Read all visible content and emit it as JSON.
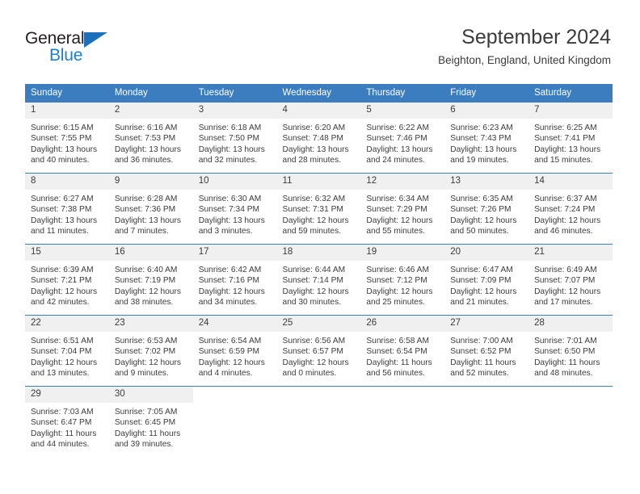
{
  "brand": {
    "name_primary": "General",
    "name_secondary": "Blue"
  },
  "header": {
    "title": "September 2024",
    "location": "Beighton, England, United Kingdom"
  },
  "columns": [
    "Sunday",
    "Monday",
    "Tuesday",
    "Wednesday",
    "Thursday",
    "Friday",
    "Saturday"
  ],
  "colors": {
    "header_blue": "#3b7dbf",
    "logo_blue": "#1c7fd0",
    "daynum_bg": "#f0f0f0",
    "text": "#3b3b3b"
  },
  "weeks": [
    [
      {
        "day": "1",
        "sunrise": "Sunrise: 6:15 AM",
        "sunset": "Sunset: 7:55 PM",
        "daylight": "Daylight: 13 hours and 40 minutes."
      },
      {
        "day": "2",
        "sunrise": "Sunrise: 6:16 AM",
        "sunset": "Sunset: 7:53 PM",
        "daylight": "Daylight: 13 hours and 36 minutes."
      },
      {
        "day": "3",
        "sunrise": "Sunrise: 6:18 AM",
        "sunset": "Sunset: 7:50 PM",
        "daylight": "Daylight: 13 hours and 32 minutes."
      },
      {
        "day": "4",
        "sunrise": "Sunrise: 6:20 AM",
        "sunset": "Sunset: 7:48 PM",
        "daylight": "Daylight: 13 hours and 28 minutes."
      },
      {
        "day": "5",
        "sunrise": "Sunrise: 6:22 AM",
        "sunset": "Sunset: 7:46 PM",
        "daylight": "Daylight: 13 hours and 24 minutes."
      },
      {
        "day": "6",
        "sunrise": "Sunrise: 6:23 AM",
        "sunset": "Sunset: 7:43 PM",
        "daylight": "Daylight: 13 hours and 19 minutes."
      },
      {
        "day": "7",
        "sunrise": "Sunrise: 6:25 AM",
        "sunset": "Sunset: 7:41 PM",
        "daylight": "Daylight: 13 hours and 15 minutes."
      }
    ],
    [
      {
        "day": "8",
        "sunrise": "Sunrise: 6:27 AM",
        "sunset": "Sunset: 7:38 PM",
        "daylight": "Daylight: 13 hours and 11 minutes."
      },
      {
        "day": "9",
        "sunrise": "Sunrise: 6:28 AM",
        "sunset": "Sunset: 7:36 PM",
        "daylight": "Daylight: 13 hours and 7 minutes."
      },
      {
        "day": "10",
        "sunrise": "Sunrise: 6:30 AM",
        "sunset": "Sunset: 7:34 PM",
        "daylight": "Daylight: 13 hours and 3 minutes."
      },
      {
        "day": "11",
        "sunrise": "Sunrise: 6:32 AM",
        "sunset": "Sunset: 7:31 PM",
        "daylight": "Daylight: 12 hours and 59 minutes."
      },
      {
        "day": "12",
        "sunrise": "Sunrise: 6:34 AM",
        "sunset": "Sunset: 7:29 PM",
        "daylight": "Daylight: 12 hours and 55 minutes."
      },
      {
        "day": "13",
        "sunrise": "Sunrise: 6:35 AM",
        "sunset": "Sunset: 7:26 PM",
        "daylight": "Daylight: 12 hours and 50 minutes."
      },
      {
        "day": "14",
        "sunrise": "Sunrise: 6:37 AM",
        "sunset": "Sunset: 7:24 PM",
        "daylight": "Daylight: 12 hours and 46 minutes."
      }
    ],
    [
      {
        "day": "15",
        "sunrise": "Sunrise: 6:39 AM",
        "sunset": "Sunset: 7:21 PM",
        "daylight": "Daylight: 12 hours and 42 minutes."
      },
      {
        "day": "16",
        "sunrise": "Sunrise: 6:40 AM",
        "sunset": "Sunset: 7:19 PM",
        "daylight": "Daylight: 12 hours and 38 minutes."
      },
      {
        "day": "17",
        "sunrise": "Sunrise: 6:42 AM",
        "sunset": "Sunset: 7:16 PM",
        "daylight": "Daylight: 12 hours and 34 minutes."
      },
      {
        "day": "18",
        "sunrise": "Sunrise: 6:44 AM",
        "sunset": "Sunset: 7:14 PM",
        "daylight": "Daylight: 12 hours and 30 minutes."
      },
      {
        "day": "19",
        "sunrise": "Sunrise: 6:46 AM",
        "sunset": "Sunset: 7:12 PM",
        "daylight": "Daylight: 12 hours and 25 minutes."
      },
      {
        "day": "20",
        "sunrise": "Sunrise: 6:47 AM",
        "sunset": "Sunset: 7:09 PM",
        "daylight": "Daylight: 12 hours and 21 minutes."
      },
      {
        "day": "21",
        "sunrise": "Sunrise: 6:49 AM",
        "sunset": "Sunset: 7:07 PM",
        "daylight": "Daylight: 12 hours and 17 minutes."
      }
    ],
    [
      {
        "day": "22",
        "sunrise": "Sunrise: 6:51 AM",
        "sunset": "Sunset: 7:04 PM",
        "daylight": "Daylight: 12 hours and 13 minutes."
      },
      {
        "day": "23",
        "sunrise": "Sunrise: 6:53 AM",
        "sunset": "Sunset: 7:02 PM",
        "daylight": "Daylight: 12 hours and 9 minutes."
      },
      {
        "day": "24",
        "sunrise": "Sunrise: 6:54 AM",
        "sunset": "Sunset: 6:59 PM",
        "daylight": "Daylight: 12 hours and 4 minutes."
      },
      {
        "day": "25",
        "sunrise": "Sunrise: 6:56 AM",
        "sunset": "Sunset: 6:57 PM",
        "daylight": "Daylight: 12 hours and 0 minutes."
      },
      {
        "day": "26",
        "sunrise": "Sunrise: 6:58 AM",
        "sunset": "Sunset: 6:54 PM",
        "daylight": "Daylight: 11 hours and 56 minutes."
      },
      {
        "day": "27",
        "sunrise": "Sunrise: 7:00 AM",
        "sunset": "Sunset: 6:52 PM",
        "daylight": "Daylight: 11 hours and 52 minutes."
      },
      {
        "day": "28",
        "sunrise": "Sunrise: 7:01 AM",
        "sunset": "Sunset: 6:50 PM",
        "daylight": "Daylight: 11 hours and 48 minutes."
      }
    ],
    [
      {
        "day": "29",
        "sunrise": "Sunrise: 7:03 AM",
        "sunset": "Sunset: 6:47 PM",
        "daylight": "Daylight: 11 hours and 44 minutes."
      },
      {
        "day": "30",
        "sunrise": "Sunrise: 7:05 AM",
        "sunset": "Sunset: 6:45 PM",
        "daylight": "Daylight: 11 hours and 39 minutes."
      },
      {
        "day": "",
        "sunrise": "",
        "sunset": "",
        "daylight": ""
      },
      {
        "day": "",
        "sunrise": "",
        "sunset": "",
        "daylight": ""
      },
      {
        "day": "",
        "sunrise": "",
        "sunset": "",
        "daylight": ""
      },
      {
        "day": "",
        "sunrise": "",
        "sunset": "",
        "daylight": ""
      },
      {
        "day": "",
        "sunrise": "",
        "sunset": "",
        "daylight": ""
      }
    ]
  ]
}
